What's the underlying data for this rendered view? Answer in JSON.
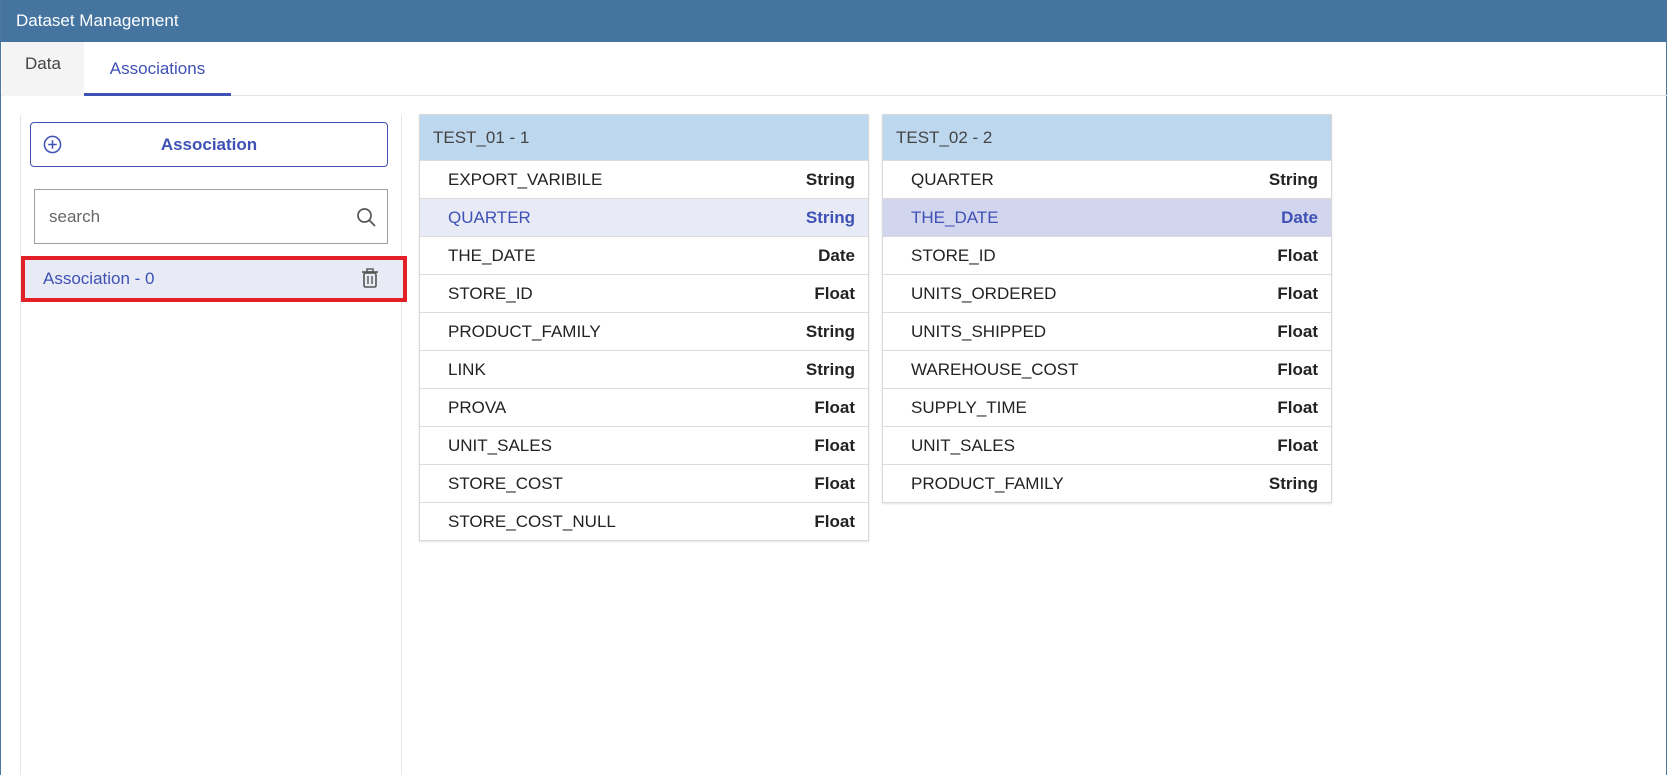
{
  "window": {
    "title": "Dataset Management"
  },
  "tabs": [
    {
      "label": "Data"
    },
    {
      "label": "Associations"
    }
  ],
  "sidebar": {
    "add_button_label": "Association",
    "search_placeholder": "search",
    "search_value": "",
    "items": [
      {
        "label": "Association - 0"
      }
    ]
  },
  "tables": [
    {
      "title": "TEST_01 - 1",
      "rows": [
        {
          "name": "EXPORT_VARIBILE",
          "type": "String"
        },
        {
          "name": "QUARTER",
          "type": "String"
        },
        {
          "name": "THE_DATE",
          "type": "Date"
        },
        {
          "name": "STORE_ID",
          "type": "Float"
        },
        {
          "name": "PRODUCT_FAMILY",
          "type": "String"
        },
        {
          "name": "LINK",
          "type": "String"
        },
        {
          "name": "PROVA",
          "type": "Float"
        },
        {
          "name": "UNIT_SALES",
          "type": "Float"
        },
        {
          "name": "STORE_COST",
          "type": "Float"
        },
        {
          "name": "STORE_COST_NULL",
          "type": "Float"
        }
      ]
    },
    {
      "title": "TEST_02 - 2",
      "rows": [
        {
          "name": "QUARTER",
          "type": "String"
        },
        {
          "name": "THE_DATE",
          "type": "Date"
        },
        {
          "name": "STORE_ID",
          "type": "Float"
        },
        {
          "name": "UNITS_ORDERED",
          "type": "Float"
        },
        {
          "name": "UNITS_SHIPPED",
          "type": "Float"
        },
        {
          "name": "WAREHOUSE_COST",
          "type": "Float"
        },
        {
          "name": "SUPPLY_TIME",
          "type": "Float"
        },
        {
          "name": "UNIT_SALES",
          "type": "Float"
        },
        {
          "name": "PRODUCT_FAMILY",
          "type": "String"
        }
      ]
    }
  ],
  "colors": {
    "titlebar": "#44749f",
    "accent": "#3f51b5",
    "table_header": "#bdd7ee",
    "highlight_border": "#e32028",
    "selected_row": "#e8eaf6",
    "selected_row_strong": "#d1d5ee"
  },
  "icons": [
    "plus-circle-icon",
    "search-icon",
    "trash-icon"
  ]
}
